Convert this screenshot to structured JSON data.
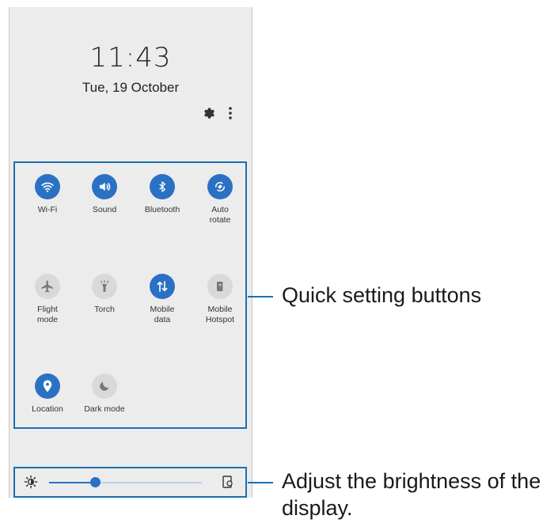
{
  "lockscreen": {
    "time": "11:43",
    "date": "Tue, 19 October"
  },
  "header_icons": [
    "settings-gear-icon",
    "more-options-icon"
  ],
  "quick_settings": {
    "tiles": [
      {
        "label": "Wi-Fi",
        "state": "on",
        "icon": "wifi-icon"
      },
      {
        "label": "Sound",
        "state": "on",
        "icon": "sound-icon"
      },
      {
        "label": "Bluetooth",
        "state": "on",
        "icon": "bluetooth-icon"
      },
      {
        "label": "Auto\nrotate",
        "state": "on",
        "icon": "auto-rotate-icon"
      },
      {
        "label": "Flight\nmode",
        "state": "off",
        "icon": "airplane-icon"
      },
      {
        "label": "Torch",
        "state": "off",
        "icon": "torch-icon"
      },
      {
        "label": "Mobile\ndata",
        "state": "on",
        "icon": "mobile-data-icon"
      },
      {
        "label": "Mobile\nHotspot",
        "state": "off",
        "icon": "hotspot-icon"
      },
      {
        "label": "Location",
        "state": "on",
        "icon": "location-icon"
      },
      {
        "label": "Dark mode",
        "state": "off",
        "icon": "dark-mode-icon"
      }
    ]
  },
  "brightness": {
    "level": 0.3,
    "icon": "brightness-icon",
    "auto_icon": "adaptive-brightness-icon"
  },
  "callouts": {
    "quick_settings": "Quick setting buttons",
    "brightness_line1": "Adjust the brightness of the",
    "brightness_line2": "display."
  },
  "colors": {
    "accent": "#2a71c4",
    "outline": "#1b6fb0",
    "panel": "#ececec",
    "tile_off": "#d9d9d9"
  }
}
